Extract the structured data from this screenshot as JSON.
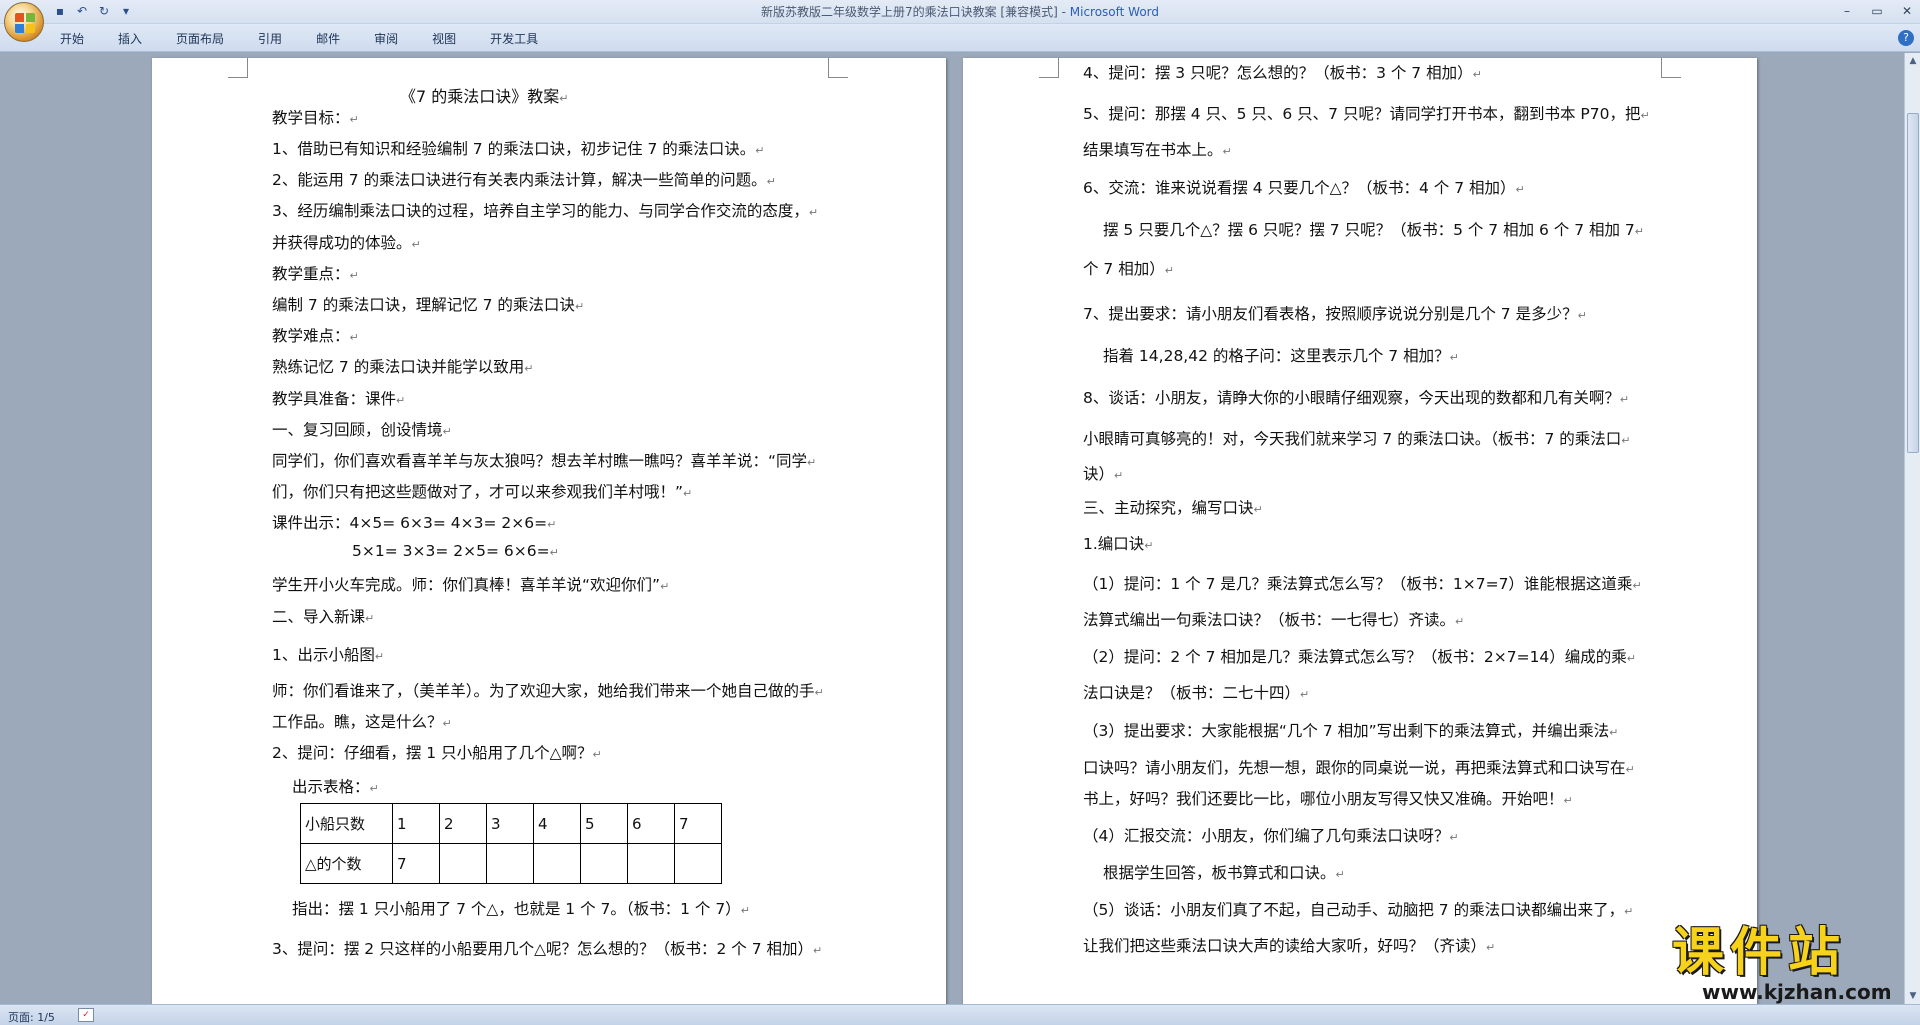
{
  "window": {
    "title": "新版苏教版二年级数学上册7的乘法口诀教案 [兼容模式] - ",
    "app_name": "Microsoft Word"
  },
  "ribbon": {
    "tabs": [
      "开始",
      "插入",
      "页面布局",
      "引用",
      "邮件",
      "审阅",
      "视图",
      "开发工具"
    ]
  },
  "status": {
    "page_count": "页面: 1/5"
  },
  "page1": {
    "title": "《7 的乘法口诀》教案",
    "lines": [
      "教学目标：",
      "1、借助已有知识和经验编制 7 的乘法口诀，初步记住 7 的乘法口诀。",
      "2、能运用 7 的乘法口诀进行有关表内乘法计算，解决一些简单的问题。",
      "3、经历编制乘法口诀的过程，培养自主学习的能力、与同学合作交流的态度，",
      "并获得成功的体验。",
      "教学重点：",
      "编制 7 的乘法口诀，理解记忆 7 的乘法口诀",
      "教学难点：",
      "熟练记忆 7 的乘法口诀并能学以致用",
      "教学具准备：课件",
      "一、复习回顾，创设情境",
      "同学们，你们喜欢看喜羊羊与灰太狼吗？想去羊村瞧一瞧吗？喜羊羊说：“同学",
      "们，你们只有把这些题做对了，才可以来参观我们羊村哦！”",
      "课件出示：4×5=    6×3=   4×3=   2×6=",
      "5×1=    3×3=   2×5=   6×6=",
      "学生开小火车完成。师：你们真棒！喜羊羊说“欢迎你们”",
      "二、导入新课",
      "1、出示小船图",
      "师：你们看谁来了，（美羊羊）。为了欢迎大家，她给我们带来一个她自己做的手",
      "工作品。瞧，这是什么？",
      "2、提问：仔细看，摆 1 只小船用了几个△啊？",
      "出示表格：",
      "指出：摆 1 只小船用了 7 个△，也就是 1 个 7。（板书：1 个 7）",
      "3、提问：摆 2 只这样的小船要用几个△呢？怎么想的？（板书：2 个 7 相加）"
    ],
    "table": {
      "row1_label": "小船只数",
      "row1": [
        "1",
        "2",
        "3",
        "4",
        "5",
        "6",
        "7"
      ],
      "row2_label": "△的个数",
      "row2": [
        "7",
        "",
        "",
        "",
        "",
        "",
        ""
      ]
    }
  },
  "page2": {
    "lines": [
      "4、提问：摆 3 只呢？怎么想的？（板书：3 个 7 相加）",
      "5、提问：那摆 4 只、5 只、6 只、7 只呢？请同学打开书本，翻到书本 P70，把",
      "结果填写在书本上。",
      "6、交流：谁来说说看摆 4 只要几个△？（板书：4 个 7 相加）",
      "摆 5 只要几个△？摆 6 只呢？摆 7 只呢？（板书：5 个 7 相加   6 个 7 相加   7",
      "个 7 相加）",
      "7、提出要求：请小朋友们看表格，按照顺序说说分别是几个 7 是多少？",
      "指着 14,28,42 的格子问：这里表示几个 7 相加？",
      "8、谈话：小朋友，请睁大你的小眼睛仔细观察，今天出现的数都和几有关啊？",
      "小眼睛可真够亮的！对，今天我们就来学习 7 的乘法口诀。（板书：7 的乘法口",
      "诀）",
      "三、主动探究，编写口诀",
      "1.编口诀",
      "（1）提问：1 个 7 是几？乘法算式怎么写？（板书：1×7=7）谁能根据这道乘",
      "法算式编出一句乘法口诀？（板书：一七得七）齐读。",
      "（2）提问：2 个 7 相加是几？乘法算式怎么写？（板书：2×7=14）编成的乘",
      "法口诀是？（板书：二七十四）",
      "（3）提出要求：大家能根据“几个 7 相加”写出剩下的乘法算式，并编出乘法",
      "口诀吗？请小朋友们，先想一想，跟你的同桌说一说，再把乘法算式和口诀写在",
      "书上，好吗？我们还要比一比，哪位小朋友写得又快又准确。开始吧！",
      "（4）汇报交流：小朋友，你们编了几句乘法口诀呀？",
      "根据学生回答，板书算式和口诀。",
      "（5）谈话：小朋友们真了不起，自己动手、动脑把 7 的乘法口诀都编出来了，",
      "让我们把这些乘法口诀大声的读给大家听，好吗？（齐读）"
    ]
  },
  "watermark": {
    "text": "课件站",
    "url": "www.kjzhan.com"
  }
}
